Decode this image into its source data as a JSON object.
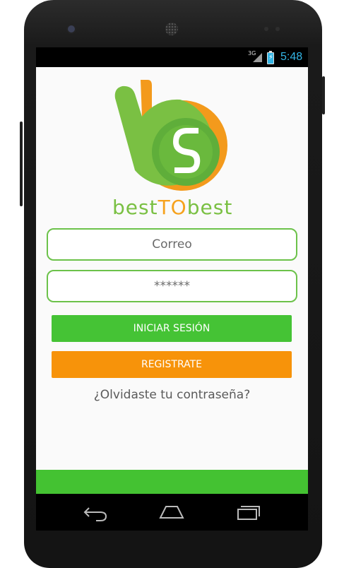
{
  "status_bar": {
    "network_label": "3G",
    "time": "5:48"
  },
  "brand": {
    "logo_mark": "b2",
    "name_part1": "best",
    "name_part2": "TO",
    "name_part3": "best"
  },
  "form": {
    "email_placeholder": "Correo",
    "password_placeholder": "******",
    "login_label": "INICIAR SESIÓN",
    "register_label": "REGISTRATE",
    "forgot_label": "¿Olvidaste tu contraseña?"
  },
  "nav": {
    "back_icon": "back-arrow-icon",
    "home_icon": "home-icon",
    "recents_icon": "recent-apps-icon"
  },
  "colors": {
    "green": "#45c335",
    "orange": "#f7930a",
    "status_time": "#33b5e5"
  }
}
